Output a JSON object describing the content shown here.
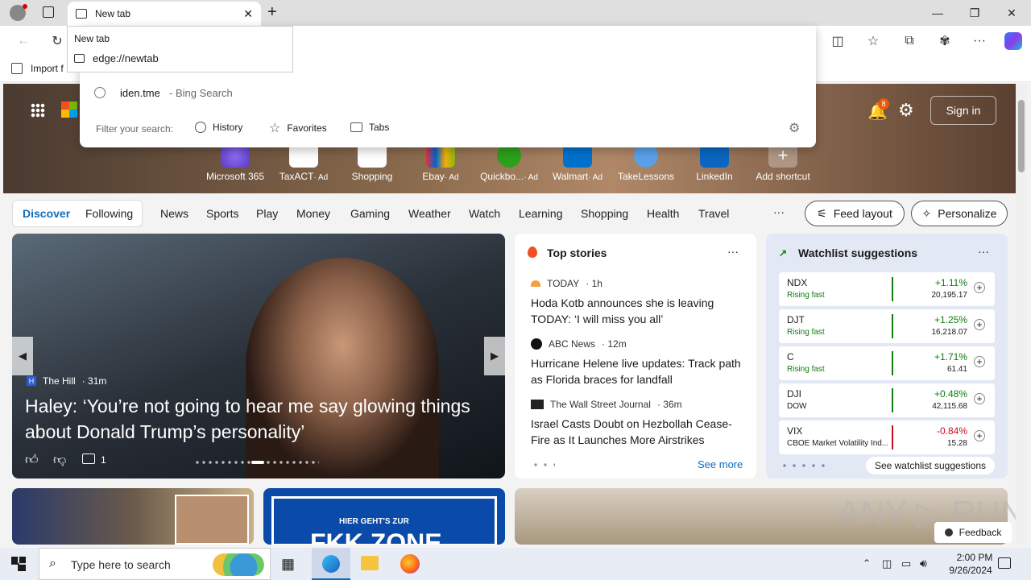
{
  "browser": {
    "tab_title": "New tab",
    "tab_tooltip_title": "New tab",
    "tab_tooltip_url": "edge://newtab",
    "address_suggestion": "iden.tme",
    "address_suggestion_suffix": "- Bing Search",
    "filter_label": "Filter your search:",
    "filter_history": "History",
    "filter_favorites": "Favorites",
    "filter_tabs": "Tabs",
    "fav_import": "Import f"
  },
  "header": {
    "notif_count": "8",
    "sign_in": "Sign in"
  },
  "shortcuts": [
    {
      "label": "Microsoft 365",
      "ad": ""
    },
    {
      "label": "TaxACT",
      "ad": "· Ad"
    },
    {
      "label": "Shopping",
      "ad": ""
    },
    {
      "label": "Ebay",
      "ad": "· Ad"
    },
    {
      "label": "Quickbo...",
      "ad": "· Ad"
    },
    {
      "label": "Walmart",
      "ad": "· Ad"
    },
    {
      "label": "TakeLessons",
      "ad": ""
    },
    {
      "label": "LinkedIn",
      "ad": ""
    },
    {
      "label": "Add shortcut",
      "ad": ""
    }
  ],
  "nav": {
    "discover": "Discover",
    "following": "Following",
    "items": [
      "News",
      "Sports",
      "Play",
      "Money",
      "Gaming",
      "Weather",
      "Watch",
      "Learning",
      "Shopping",
      "Health",
      "Travel"
    ],
    "more": "···",
    "feed_layout": "Feed layout",
    "personalize": "Personalize"
  },
  "hero_story": {
    "source": "The Hill",
    "time": "· 31m",
    "headline": "Haley: ‘You’re not going to hear me say glowing things about Donald Trump’s personality’",
    "comments": "1"
  },
  "top_stories": {
    "title": "Top stories",
    "items": [
      {
        "source": "TODAY",
        "time": "· 1h",
        "headline": "Hoda Kotb announces she is leaving TODAY: ‘I will miss you all’"
      },
      {
        "source": "ABC News",
        "time": "· 12m",
        "headline": "Hurricane Helene live updates: Track path as Florida braces for landfall"
      },
      {
        "source": "The Wall Street Journal",
        "time": "· 36m",
        "headline": "Israel Casts Doubt on Hezbollah Cease-Fire as It Launches More Airstrikes"
      }
    ],
    "see_more": "See more"
  },
  "watchlist": {
    "title": "Watchlist suggestions",
    "items": [
      {
        "sym": "NDX",
        "sub": "Rising fast",
        "pct": "+1.11%",
        "price": "20,195.17",
        "up": true
      },
      {
        "sym": "DJT",
        "sub": "Rising fast",
        "pct": "+1.25%",
        "price": "16,218.07",
        "up": true
      },
      {
        "sym": "C",
        "sub": "Rising fast",
        "pct": "+1.71%",
        "price": "61.41",
        "up": true
      },
      {
        "sym": "DJI",
        "sub": "DOW",
        "pct": "+0.48%",
        "price": "42,115.68",
        "up": true
      },
      {
        "sym": "VIX",
        "sub": "CBOE Market Volatility Ind...",
        "pct": "-0.84%",
        "price": "15.28",
        "up": false
      }
    ],
    "see_all": "See watchlist suggestions"
  },
  "lower": {
    "banner_small": "HIER GEHT'S ZUR",
    "banner_big": "FKK ZONE",
    "feedback": "Feedback"
  },
  "taskbar": {
    "search": "Type here to search",
    "time": "2:00 PM",
    "date": "9/26/2024"
  },
  "colors": {
    "accent": "#0f6cbd",
    "up": "#107c10",
    "down": "#c50f1f"
  }
}
